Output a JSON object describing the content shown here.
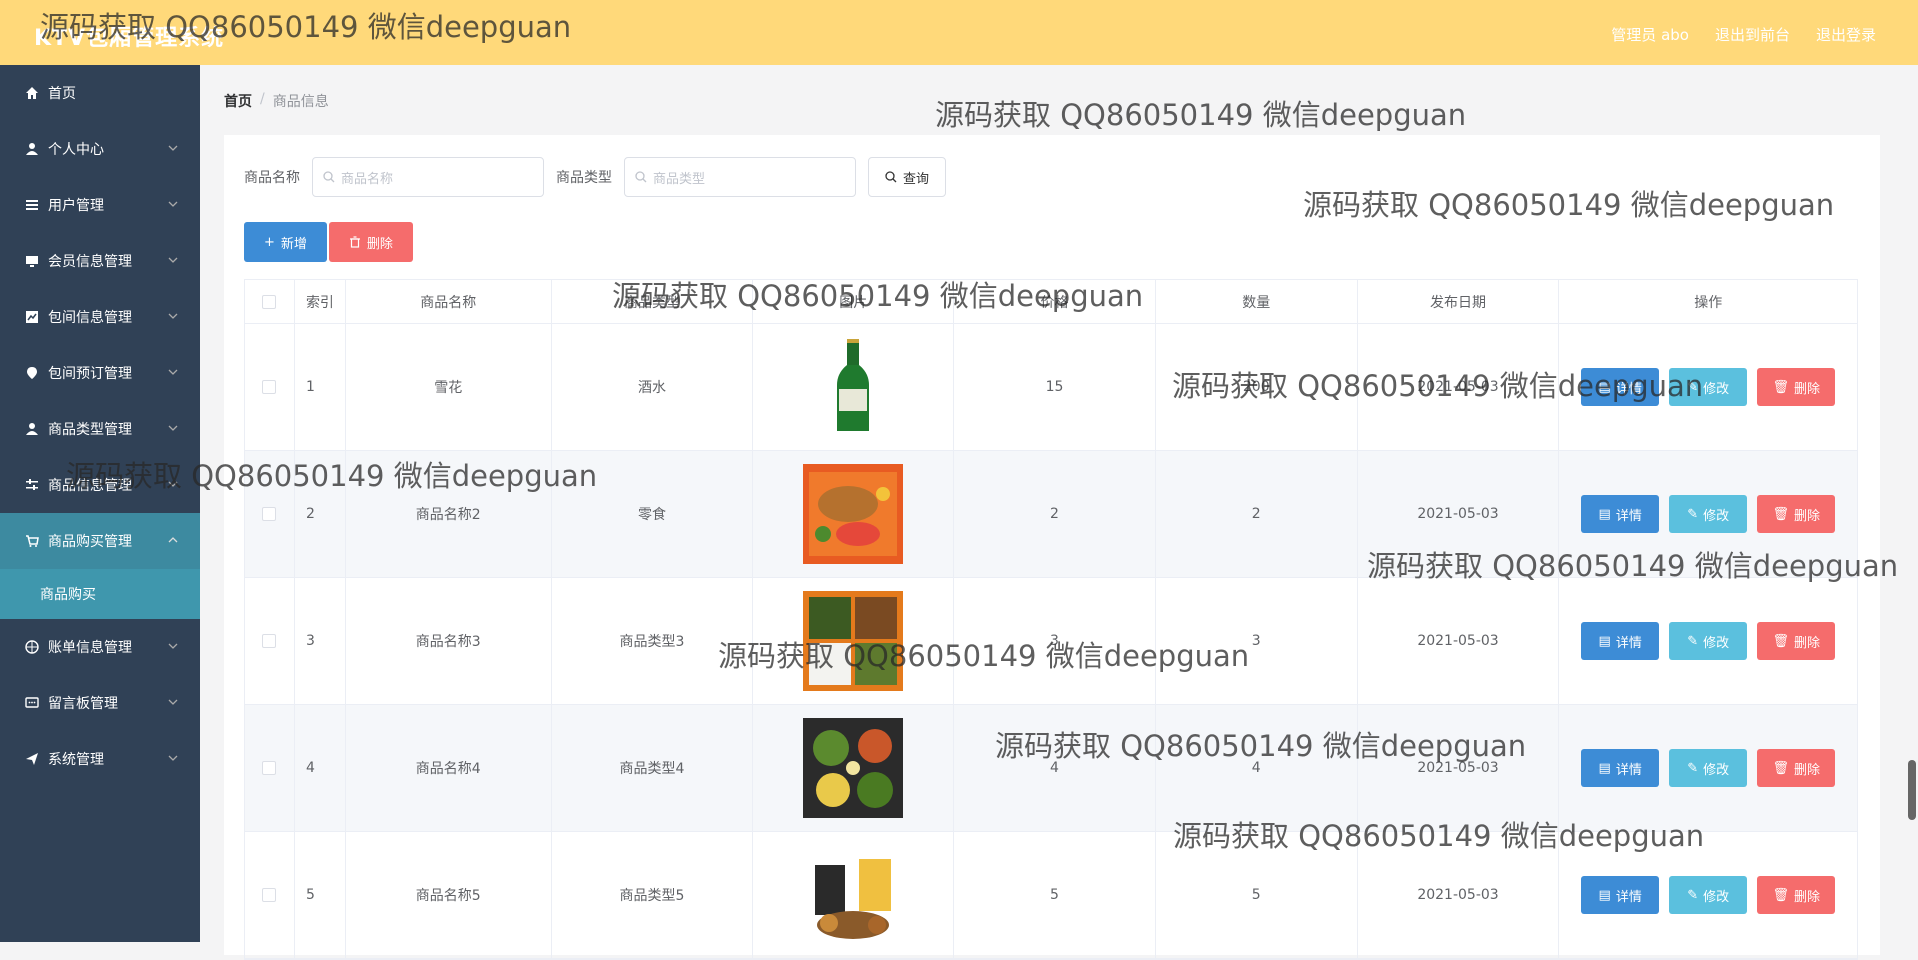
{
  "app": {
    "title": "KTV包厢管理系统"
  },
  "header": {
    "admin_label": "管理员 abo",
    "back_front": "退出到前台",
    "logout": "退出登录"
  },
  "sidebar": {
    "items": [
      {
        "label": "首页",
        "icon": "home-icon"
      },
      {
        "label": "个人中心",
        "icon": "user-icon"
      },
      {
        "label": "用户管理",
        "icon": "list-icon"
      },
      {
        "label": "会员信息管理",
        "icon": "monitor-icon"
      },
      {
        "label": "包间信息管理",
        "icon": "chart-icon"
      },
      {
        "label": "包间预订管理",
        "icon": "location-icon"
      },
      {
        "label": "商品类型管理",
        "icon": "user-icon"
      },
      {
        "label": "商品信息管理",
        "icon": "sliders-icon"
      },
      {
        "label": "商品购买管理",
        "icon": "cart-icon"
      },
      {
        "label": "账单信息管理",
        "icon": "globe-icon"
      },
      {
        "label": "留言板管理",
        "icon": "chat-icon"
      },
      {
        "label": "系统管理",
        "icon": "send-icon"
      }
    ],
    "submenu_label": "商品购买"
  },
  "breadcrumb": {
    "home": "首页",
    "separator": "/",
    "current": "商品信息"
  },
  "search": {
    "name_label": "商品名称",
    "name_placeholder": "商品名称",
    "type_label": "商品类型",
    "type_placeholder": "商品类型",
    "query_label": "查询"
  },
  "actions": {
    "add_label": "新增",
    "delete_label": "删除"
  },
  "table": {
    "headers": [
      "索引",
      "商品名称",
      "商品类型",
      "图片",
      "价格",
      "数量",
      "发布日期",
      "操作"
    ],
    "rows": [
      {
        "index": "1",
        "name": "雪花",
        "type": "酒水",
        "image": "beer-bottle",
        "price": "15",
        "qty": "200",
        "date": "2021-05-03"
      },
      {
        "index": "2",
        "name": "商品名称2",
        "type": "零食",
        "image": "fried-food",
        "price": "2",
        "qty": "2",
        "date": "2021-05-03"
      },
      {
        "index": "3",
        "name": "商品名称3",
        "type": "商品类型3",
        "image": "bento-box",
        "price": "3",
        "qty": "3",
        "date": "2021-05-03"
      },
      {
        "index": "4",
        "name": "商品名称4",
        "type": "商品类型4",
        "image": "meal-box",
        "price": "4",
        "qty": "4",
        "date": "2021-05-03"
      },
      {
        "index": "5",
        "name": "商品名称5",
        "type": "商品类型5",
        "image": "snack-pack",
        "price": "5",
        "qty": "5",
        "date": "2021-05-03"
      }
    ],
    "op_detail": "详情",
    "op_edit": "修改",
    "op_delete": "删除"
  },
  "watermark": "源码获取 QQ86050149 微信deepguan",
  "colors": {
    "topbar": "#ffd97a",
    "sidebar": "#304156",
    "active_menu": "#3d8aa0",
    "primary": "#3d8cd6",
    "info": "#5bc0de",
    "danger": "#f56c6c"
  }
}
